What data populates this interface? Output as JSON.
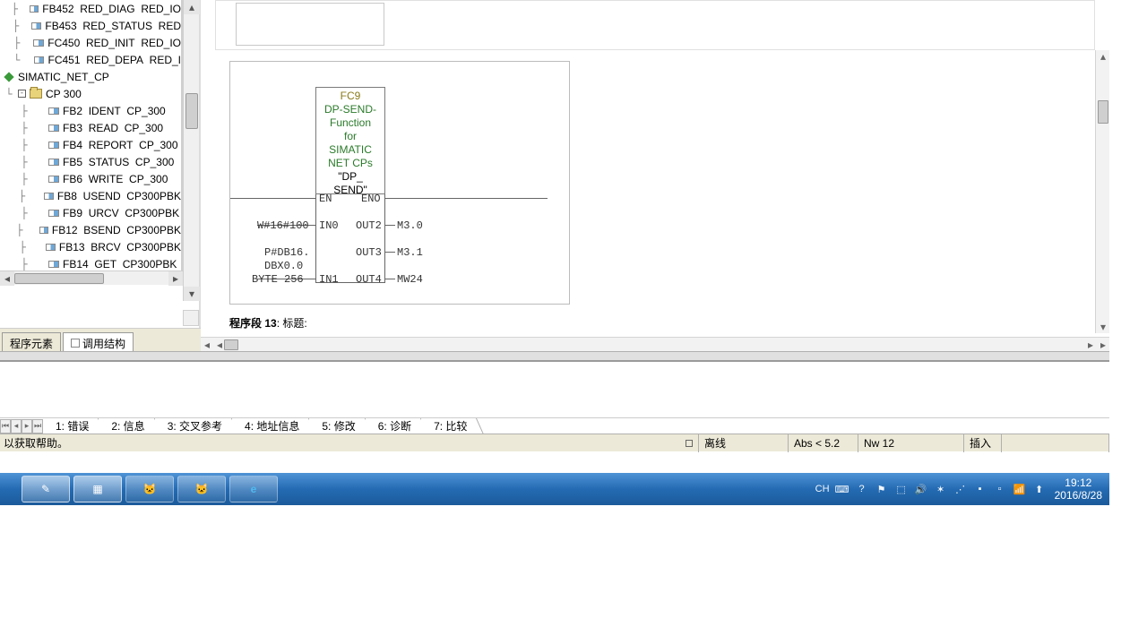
{
  "tree": {
    "top_items": [
      {
        "code": "FB452",
        "name": "RED_DIAG",
        "lib": "RED_IO"
      },
      {
        "code": "FB453",
        "name": "RED_STATUS",
        "lib": "RED"
      },
      {
        "code": "FC450",
        "name": "RED_INIT",
        "lib": "RED_IO"
      },
      {
        "code": "FC451",
        "name": "RED_DEPA",
        "lib": "RED_I"
      }
    ],
    "group": "SIMATIC_NET_CP",
    "subgroup": "CP 300",
    "cp_items": [
      {
        "code": "FB2",
        "name": "IDENT",
        "lib": "CP_300"
      },
      {
        "code": "FB3",
        "name": "READ",
        "lib": "CP_300"
      },
      {
        "code": "FB4",
        "name": "REPORT",
        "lib": "CP_300"
      },
      {
        "code": "FB5",
        "name": "STATUS",
        "lib": "CP_300"
      },
      {
        "code": "FB6",
        "name": "WRITE",
        "lib": "CP_300"
      },
      {
        "code": "FB8",
        "name": "USEND",
        "lib": "CP300PBK"
      },
      {
        "code": "FB9",
        "name": "URCV",
        "lib": "CP300PBK"
      },
      {
        "code": "FB12",
        "name": "BSEND",
        "lib": "CP300PBK"
      },
      {
        "code": "FB13",
        "name": "BRCV",
        "lib": "CP300PBK"
      },
      {
        "code": "FB14",
        "name": "GET",
        "lib": "CP300PBK"
      }
    ]
  },
  "side_tabs": {
    "a": "程序元素",
    "b": "调用结构"
  },
  "block": {
    "title": "FC9",
    "sub1": "DP-SEND-",
    "sub2": "Function",
    "sub3": "for",
    "sub4": "SIMATIC",
    "sub5": "NET CPs",
    "name1": "\"DP_",
    "name2": "SEND\"",
    "en": "EN",
    "eno": "ENO",
    "in0": "IN0",
    "out2": "OUT2",
    "out3": "OUT3",
    "in1": "IN1",
    "out4": "OUT4",
    "l_in0": "W#16#100",
    "l_in1a": "P#DB16.",
    "l_in1b": "DBX0.0",
    "l_in1c": "BYTE 256",
    "r_out2": "M3.0",
    "r_out3": "M3.1",
    "r_out4": "MW24"
  },
  "net_title_label": "程序段",
  "net_title_num": "13",
  "net_title_suffix": ": 标题:",
  "msg_tabs": [
    "1: 错误",
    "2: 信息",
    "3: 交叉参考",
    "4: 地址信息",
    "5: 修改",
    "6: 诊断",
    "7: 比较"
  ],
  "status": {
    "help": "以获取帮助。",
    "offline": "离线",
    "abs": "Abs < 5.2",
    "nw": "Nw 12",
    "ins": "插入"
  },
  "tray": {
    "ime": "CH",
    "time": "19:12",
    "date": "2016/8/28"
  }
}
